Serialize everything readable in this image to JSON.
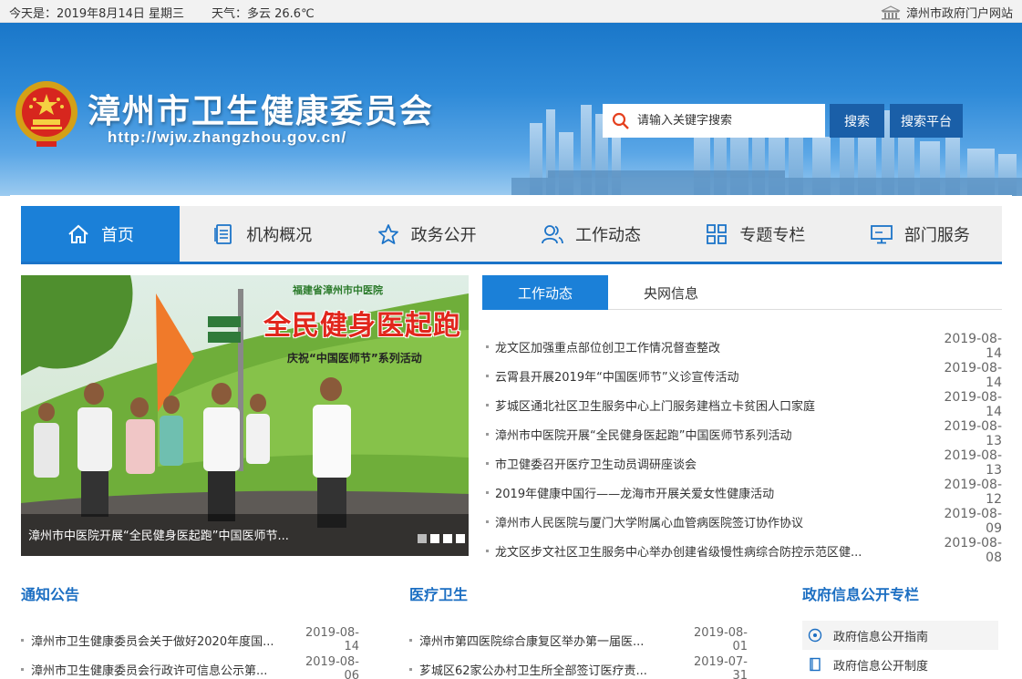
{
  "topbar": {
    "date": "今天是：2019年8月14日 星期三",
    "weather": "天气：多云 26.6℃",
    "portal_link": "漳州市政府门户网站"
  },
  "header": {
    "site_title": "漳州市卫生健康委员会",
    "site_url": "http://wjw.zhangzhou.gov.cn/",
    "search_placeholder": "请输入关键字搜索",
    "search_button": "搜索",
    "search_platform_button": "搜索平台"
  },
  "nav": {
    "items": [
      {
        "label": "首页",
        "icon": "home-icon"
      },
      {
        "label": "机构概况",
        "icon": "document-icon"
      },
      {
        "label": "政务公开",
        "icon": "star-icon"
      },
      {
        "label": "工作动态",
        "icon": "users-icon"
      },
      {
        "label": "专题专栏",
        "icon": "grid-icon"
      },
      {
        "label": "部门服务",
        "icon": "monitor-icon"
      }
    ]
  },
  "carousel": {
    "caption": "漳州市中医院开展“全民健身医起跑”中国医师节...",
    "poster_org": "福建省漳州市中医院",
    "poster_title": "全民健身医起跑",
    "poster_sub": "庆祝“中国医师节”系列活动",
    "slide_count": 4,
    "active_slide": 1
  },
  "news": {
    "tabs": [
      "工作动态",
      "央网信息"
    ],
    "items": [
      {
        "title": "龙文区加强重点部位创卫工作情况督查整改",
        "date": "2019-08-14"
      },
      {
        "title": "云霄县开展2019年“中国医师节”义诊宣传活动",
        "date": "2019-08-14"
      },
      {
        "title": "芗城区通北社区卫生服务中心上门服务建档立卡贫困人口家庭",
        "date": "2019-08-14"
      },
      {
        "title": "漳州市中医院开展“全民健身医起跑”中国医师节系列活动",
        "date": "2019-08-13"
      },
      {
        "title": "市卫健委召开医疗卫生动员调研座谈会",
        "date": "2019-08-13"
      },
      {
        "title": "2019年健康中国行——龙海市开展关爱女性健康活动",
        "date": "2019-08-12"
      },
      {
        "title": "漳州市人民医院与厦门大学附属心血管病医院签订协作协议",
        "date": "2019-08-09"
      },
      {
        "title": "龙文区步文社区卫生服务中心举办创建省级慢性病综合防控示范区健...",
        "date": "2019-08-08"
      }
    ]
  },
  "notices": {
    "title": "通知公告",
    "items": [
      {
        "title": "漳州市卫生健康委员会关于做好2020年度国...",
        "date": "2019-08-14"
      },
      {
        "title": "漳州市卫生健康委员会行政许可信息公示第...",
        "date": "2019-08-06"
      }
    ]
  },
  "medical": {
    "title": "医疗卫生",
    "items": [
      {
        "title": "漳州市第四医院综合康复区举办第一届医...",
        "date": "2019-08-01"
      },
      {
        "title": "芗城区62家公办村卫生所全部签订医疗责...",
        "date": "2019-07-31"
      }
    ]
  },
  "gov_info": {
    "title": "政府信息公开专栏",
    "items": [
      {
        "label": "政府信息公开指南",
        "icon": "compass-icon"
      },
      {
        "label": "政府信息公开制度",
        "icon": "book-icon"
      }
    ]
  },
  "colors": {
    "primary": "#1b80d8",
    "nav_border": "#1b73c8",
    "section_title": "#1b6ec2",
    "search_button": "#1a5fa8"
  }
}
